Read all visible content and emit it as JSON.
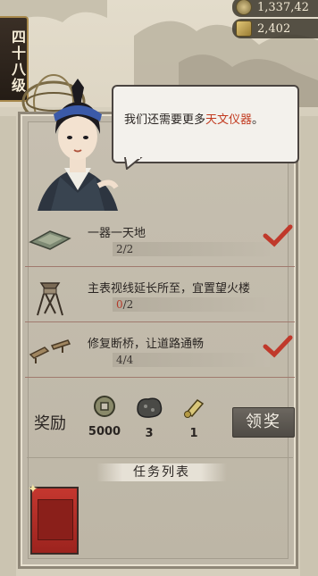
{
  "resources": {
    "coins": "1,337,42",
    "gold": "2,402",
    "coins_icon": "coin-icon",
    "gold_icon": "gold-ingot-icon"
  },
  "level": {
    "label": "四十八级"
  },
  "dialog": {
    "text_before": "我们还需要更多",
    "highlight": "天文仪器",
    "text_after": "。",
    "highlight_color": "#c23a1f"
  },
  "tasks": [
    {
      "name": "一器一天地",
      "progress_done": "2",
      "progress_total": "/2",
      "completed": true,
      "icon": "instrument-icon"
    },
    {
      "name": "主表视线延长所至，宜置望火楼",
      "progress_done": "0",
      "progress_total": "/2",
      "completed": false,
      "icon": "watchtower-icon"
    },
    {
      "name": "修复断桥，让道路通畅",
      "progress_done": "4",
      "progress_total": "/4",
      "completed": true,
      "icon": "bridge-icon"
    }
  ],
  "reward": {
    "label": "奖励",
    "items": [
      {
        "icon": "coin-icon",
        "value": "5000"
      },
      {
        "icon": "ore-icon",
        "value": "3"
      },
      {
        "icon": "scroll-icon",
        "value": "1"
      }
    ],
    "claim_label": "领奖"
  },
  "task_list": {
    "title": "任务列表"
  },
  "colors": {
    "check": "#c0392b",
    "accent": "#c23a1f"
  }
}
